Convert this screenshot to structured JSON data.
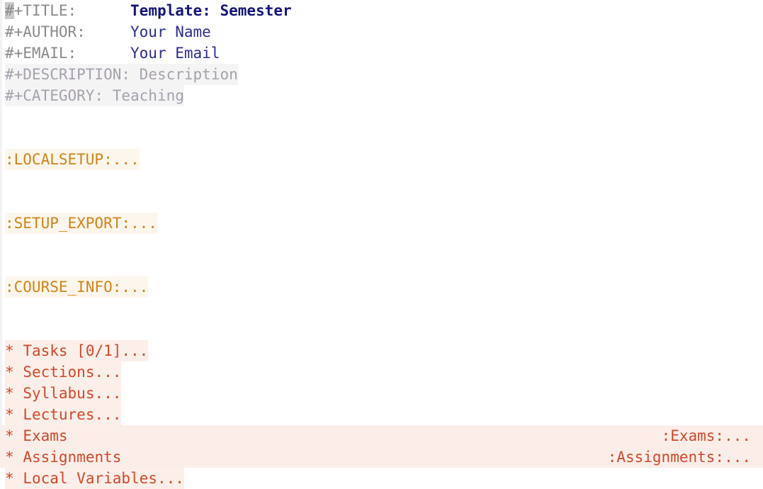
{
  "editor": {
    "mode": "org-mode",
    "cursor_char": "#"
  },
  "colors": {
    "background": "#ffffff",
    "keyword": "#8a8a8a",
    "keyword_dim": "#a6a0ad",
    "title_value": "#15157a",
    "value": "#2b2b8f",
    "drawer": "#d08418",
    "drawer_bg": "#fdf6ec",
    "headline": "#d2482a",
    "headline_bg": "#fcefe9",
    "fringe": "#f2f2f2",
    "cursor": "#c9c9c9"
  },
  "header": {
    "lines": [
      {
        "keyword": "#+TITLE:",
        "pad": "      ",
        "value": "Template: Semester",
        "style": "title"
      },
      {
        "keyword": "#+AUTHOR:",
        "pad": "     ",
        "value": "Your Name",
        "style": "value"
      },
      {
        "keyword": "#+EMAIL:",
        "pad": "      ",
        "value": "Your Email",
        "style": "value"
      },
      {
        "keyword": "#+DESCRIPTION:",
        "pad": " ",
        "value": "Description",
        "style": "dim"
      },
      {
        "keyword": "#+CATEGORY:",
        "pad": " ",
        "value": "Teaching",
        "style": "dim"
      }
    ]
  },
  "drawers": [
    {
      "label": ":LOCALSETUP:..."
    },
    {
      "label": ":SETUP_EXPORT:..."
    },
    {
      "label": ":COURSE_INFO:..."
    }
  ],
  "headlines": [
    {
      "stars": "*",
      "title": "Tasks [0/1]...",
      "tag": "",
      "full_width": false
    },
    {
      "stars": "*",
      "title": "Sections...",
      "tag": "",
      "full_width": false
    },
    {
      "stars": "*",
      "title": "Syllabus...",
      "tag": "",
      "full_width": false
    },
    {
      "stars": "*",
      "title": "Lectures...",
      "tag": "",
      "full_width": false
    },
    {
      "stars": "*",
      "title": "Exams",
      "tag": ":Exams:...",
      "full_width": true
    },
    {
      "stars": "*",
      "title": "Assignments",
      "tag": ":Assignments:...",
      "full_width": true
    },
    {
      "stars": "*",
      "title": "Local Variables...",
      "tag": "",
      "full_width": false
    }
  ]
}
